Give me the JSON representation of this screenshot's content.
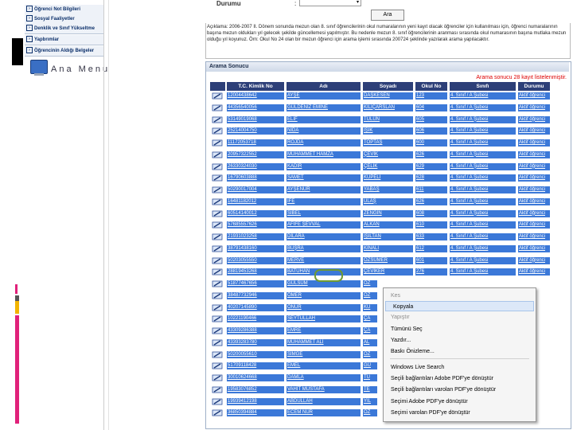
{
  "left_nav": {
    "items": [
      {
        "label": "Öğrenci Not Bilgileri"
      },
      {
        "label": "Sosyal Faaliyetler"
      },
      {
        "label": "Denklik ve Sınıf Yükseltme"
      },
      {
        "label": "Yapbrımlar"
      },
      {
        "label": "Öğrencinin Aldığı Belgeler"
      }
    ],
    "menu_title": "Ana Menu"
  },
  "search_form": {
    "durumu_label": "Durumu",
    "colon": ":",
    "select_value": "",
    "search_button": "Ara"
  },
  "note": "Açıklama: 2006-2007 II. Dönem sonunda mezun olan 8. sınıf öğrencilerinin okul numaralarının yeni kayıt olacak öğrenciler için kullanılması için, öğrenci numaralarının başına mezun oldukları yıl gelecek şekilde güncellemesi yapılmıştır. Bu nedenle mezun 8. sınıf öğrencilerinin aranması sırasında okul numarasının başına mutlaka mezun olduğu yıl koyunuz. Örn: Okul No 24 olan bir mezun öğrenci için arama işlemi sırasında 200724 şeklinde yazılarak arama yapılacaktır.",
  "results": {
    "panel_title": "Arama Sonucu",
    "count_text": "Arama sonucu 28 kayıt listelenmiştir.",
    "columns": [
      "T.C. Kimlik No",
      "Adı",
      "Soyadı",
      "Okul No",
      "Sınıfı",
      "Durumu"
    ],
    "rows": [
      [
        "12004438642",
        "AYŞE",
        "DAŞKESEN",
        "123",
        "4. Sınıf / A Şubesi",
        "Aktif öğrenci"
      ],
      [
        "44356540056",
        "GÜLDENİZ EMİNE",
        "KILIÇARSLAN",
        "604",
        "4. Sınıf / A Şubesi",
        "Aktif öğrenci"
      ],
      [
        "53149019068",
        "ELİF",
        "TÜLÜN",
        "605",
        "4. Sınıf / A Şubesi",
        "Aktif öğrenci"
      ],
      [
        "25214004750",
        "NİDA",
        "IŞIK",
        "606",
        "4. Sınıf / A Şubesi",
        "Aktif öğrenci"
      ],
      [
        "11172053718",
        "ROJDA",
        "TOPTAŞ",
        "600",
        "4. Sınıf / A Şubesi",
        "Aktif öğrenci"
      ],
      [
        "20957322552",
        "MUHAMMET HAMZA",
        "ÇEVİK",
        "626",
        "4. Sınıf / A Şubesi",
        "Aktif öğrenci"
      ],
      [
        "26330324030",
        "KADİR",
        "ÇELİK",
        "629",
        "4. Sınıf / A Şubesi",
        "Aktif öğrenci"
      ],
      [
        "16790603888",
        "SAMET",
        "KUPELİ",
        "628",
        "4. Sınıf / A Şubesi",
        "Aktif öğrenci"
      ],
      [
        "50290017004",
        "AYŞENUR",
        "YABAŞ",
        "611",
        "4. Sınıf / A Şubesi",
        "Aktif öğrenci"
      ],
      [
        "16481182012",
        "İFE",
        "ULAŞ",
        "626",
        "4. Sınıf / A Şubesi",
        "Aktif öğrenci"
      ],
      [
        "60514140012",
        "SİBEL",
        "ZENGİN",
        "608",
        "4. Sınıf / A Şubesi",
        "Aktif öğrenci"
      ],
      [
        "57685557626",
        "AFİFE ŞEVVAL",
        "ALKAN",
        "610",
        "4. Sınıf / A Şubesi",
        "Aktif öğrenci"
      ],
      [
        "21931023258",
        "DİLARA",
        "IŞILTAN",
        "633",
        "4. Sınıf / A Şubesi",
        "Aktif öğrenci"
      ],
      [
        "38791438160",
        "BUŞRA",
        "KINALI",
        "612",
        "4. Sınıf / A Şubesi",
        "Aktif öğrenci"
      ],
      [
        "50203055550",
        "MERVE",
        "ÖZSÜMER",
        "601",
        "4. Sınıf / A Şubesi",
        "Aktif öğrenci"
      ],
      [
        "28819453268",
        "BATUHAN",
        "ÇEVİKER",
        "276",
        "4. Sınıf / A Şubesi",
        "Aktif öğrenci"
      ],
      [
        "51877467656",
        "GÜLSÜM",
        "ÖZ",
        "",
        "",
        ""
      ],
      [
        "38487732946",
        "ÖMER",
        "ÖZ",
        "",
        "",
        ""
      ],
      [
        "40207145890",
        "ONUR",
        "KU",
        "",
        "",
        ""
      ],
      [
        "10221190466",
        "SEYTULLAH",
        "ÇA",
        "",
        "",
        ""
      ],
      [
        "43309286388",
        "EMRE",
        "ÇA",
        "",
        "",
        ""
      ],
      [
        "43393283780",
        "MUHAMMET ALİ",
        "AL",
        "",
        "",
        ""
      ],
      [
        "50200055610",
        "SİMGE",
        "ÖZ",
        "",
        "",
        ""
      ],
      [
        "51709118428",
        "EMEL",
        "GÜ",
        "",
        "",
        ""
      ],
      [
        "30010624668",
        "DAMLA",
        "TU",
        "",
        "",
        ""
      ],
      [
        "19583076852",
        "VAHİT MUSTAFA",
        "TE",
        "",
        "",
        ""
      ],
      [
        "19939412198",
        "ABDULLAH",
        "YIL",
        "",
        "",
        ""
      ],
      [
        "36850394884",
        "ECEM NUR",
        "ÖZ",
        "",
        "",
        ""
      ]
    ]
  },
  "context_menu": {
    "items": [
      {
        "label": "Kes",
        "disabled": true
      },
      {
        "label": "Kopyala",
        "hover": true
      },
      {
        "label": "Yapıştır",
        "disabled": true
      },
      {
        "label": "Tümünü Seç"
      },
      {
        "label": "Yazdır..."
      },
      {
        "label": "Baskı Önizleme..."
      },
      {
        "label": "Windows Live Search"
      },
      {
        "label": "Seçili bağlantıları Adobe PDF'ye dönüştür"
      },
      {
        "label": "Seçili bağlantıları varolan PDF'ye dönüştür"
      },
      {
        "label": "Seçimi Adobe PDF'ye dönüştür"
      },
      {
        "label": "Seçimi varolan PDF'ye dönüştür"
      }
    ]
  },
  "colors": {
    "selection": "#3b78d8",
    "header_bg": "#2d3f78",
    "count_text": "#dd0000",
    "highlight": "#6f9a32"
  }
}
